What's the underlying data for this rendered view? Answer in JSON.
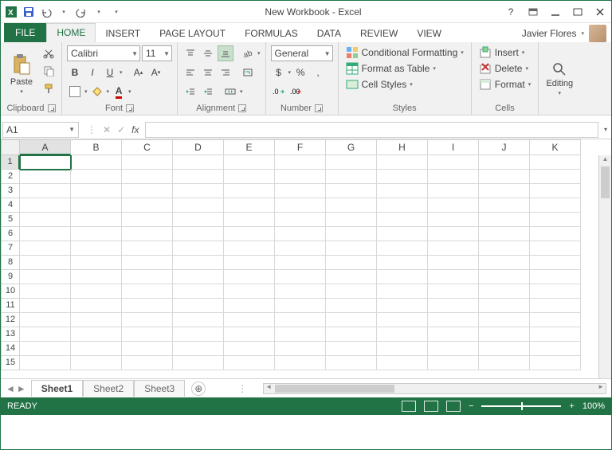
{
  "titlebar": {
    "title": "New Workbook - Excel"
  },
  "ribbon_tabs": {
    "file": "FILE",
    "tabs": [
      "HOME",
      "INSERT",
      "PAGE LAYOUT",
      "FORMULAS",
      "DATA",
      "REVIEW",
      "VIEW"
    ],
    "active": 0,
    "user_name": "Javier Flores"
  },
  "ribbon": {
    "clipboard": {
      "label": "Clipboard",
      "paste": "Paste"
    },
    "font": {
      "label": "Font",
      "name": "Calibri",
      "size": "11",
      "bold": "B",
      "italic": "I",
      "underline": "U"
    },
    "alignment": {
      "label": "Alignment"
    },
    "number": {
      "label": "Number",
      "format": "General",
      "currency": "$",
      "percent": "%",
      "comma": ","
    },
    "styles": {
      "label": "Styles",
      "conditional": "Conditional Formatting",
      "table": "Format as Table",
      "cell": "Cell Styles"
    },
    "cells": {
      "label": "Cells",
      "insert": "Insert",
      "delete": "Delete",
      "format": "Format"
    },
    "editing": {
      "label": "Editing"
    }
  },
  "formula_bar": {
    "name_box": "A1",
    "fx": "fx"
  },
  "grid": {
    "columns": [
      "A",
      "B",
      "C",
      "D",
      "E",
      "F",
      "G",
      "H",
      "I",
      "J",
      "K"
    ],
    "rows": [
      1,
      2,
      3,
      4,
      5,
      6,
      7,
      8,
      9,
      10,
      11,
      12,
      13,
      14,
      15
    ],
    "active_col": 0,
    "active_row": 0
  },
  "sheets": {
    "tabs": [
      "Sheet1",
      "Sheet2",
      "Sheet3"
    ],
    "active": 0
  },
  "status": {
    "ready": "READY",
    "zoom": "100%"
  }
}
